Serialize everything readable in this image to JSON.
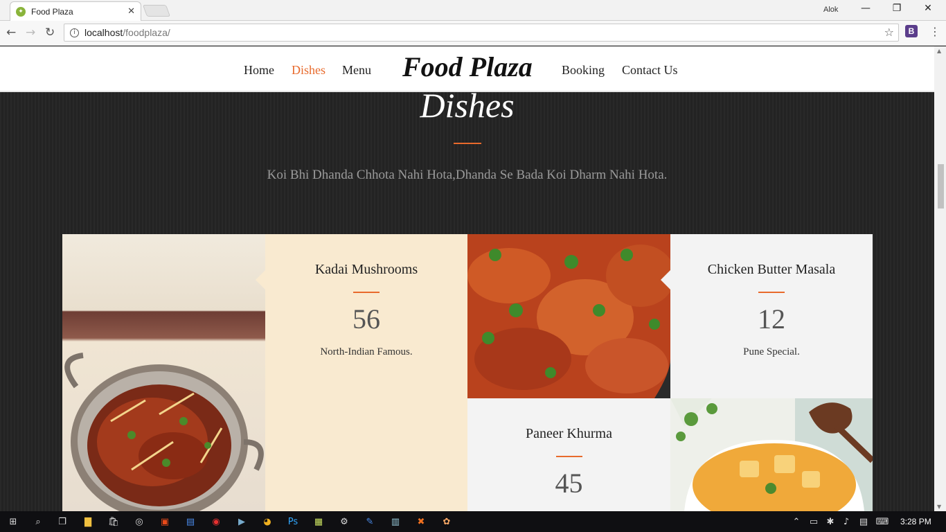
{
  "browser": {
    "tab_title": "Food Plaza",
    "tab_favicon": "fork-knife-icon",
    "profile_name": "Alok",
    "url_host": "localhost",
    "url_path": "/foodplaza/"
  },
  "nav": {
    "items": [
      {
        "label": "Home",
        "active": false
      },
      {
        "label": "Dishes",
        "active": true
      },
      {
        "label": "Menu",
        "active": false
      },
      {
        "label": "Booking",
        "active": false
      },
      {
        "label": "Contact Us",
        "active": false
      }
    ],
    "brand": "Food Plaza"
  },
  "section": {
    "title": "Dishes",
    "tagline": "Koi Bhi Dhanda Chhota Nahi Hota,Dhanda Se Bada Koi Dharm Nahi Hota."
  },
  "dishes": [
    {
      "name": "Kadai Mushrooms",
      "price": "56",
      "desc": "North-Indian Famous."
    },
    {
      "name": "Chicken Butter Masala",
      "price": "12",
      "desc": "Pune Special."
    },
    {
      "name": "Paneer Khurma",
      "price": "45",
      "desc": ""
    }
  ],
  "taskbar": {
    "clock": "3:28 PM"
  },
  "colors": {
    "accent": "#e86a2c",
    "card_cream": "#f9ead0",
    "card_grey": "#f3f3f3",
    "page_dark": "#252525"
  }
}
